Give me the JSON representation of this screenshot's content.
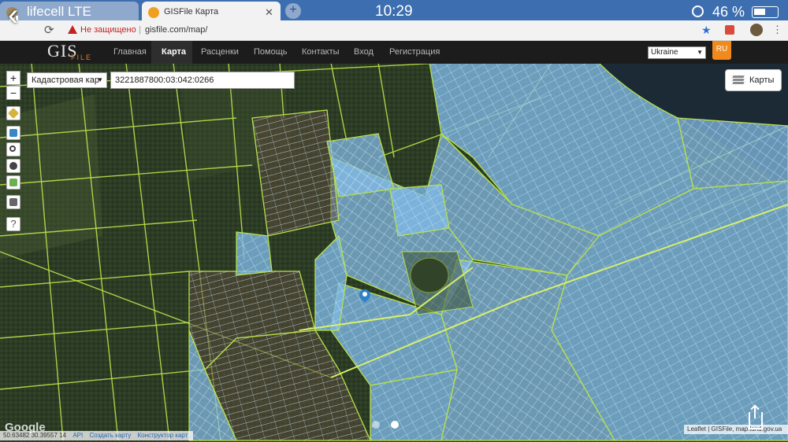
{
  "statusbar": {
    "carrier": "lifecell  LTE",
    "time": "10:29",
    "battery": "46 %"
  },
  "tabs": [
    {
      "title": "",
      "active": false
    },
    {
      "title": "GISFile Карта",
      "active": true
    }
  ],
  "addressbar": {
    "security_warning": "Не защищено",
    "url": "gisfile.com/map/"
  },
  "site": {
    "logo": {
      "gis": "GIS",
      "file": "FILE"
    },
    "nav": [
      {
        "label": "Главная",
        "active": false
      },
      {
        "label": "Карта",
        "active": true
      },
      {
        "label": "Расценки",
        "active": false
      },
      {
        "label": "Помощь",
        "active": false
      },
      {
        "label": "Контакты",
        "active": false
      },
      {
        "label": "Вход",
        "active": false
      },
      {
        "label": "Регистрация",
        "active": false
      }
    ],
    "country": "Ukraine",
    "language": "RU"
  },
  "map": {
    "zoom_in": "+",
    "zoom_out": "−",
    "layer_select": "Кадастровая кар",
    "search_value": "3221887800:03:042:0266",
    "maps_button": "Карты",
    "tools": [
      "ruler-icon",
      "layers-icon",
      "search-icon",
      "clear-icon",
      "terrain-icon",
      "print-icon",
      "help-icon"
    ],
    "help_label": "?",
    "coords": "50.63482 30.39557 14",
    "coord_links": [
      "API",
      "Создать карту",
      "Конструктор карт"
    ],
    "attribution": "Leaflet | GISFile, map.land.gov.ua",
    "watermark": "Google"
  },
  "colors": {
    "statusbar": "#3d6fb0",
    "parcel_fill": "#8ec6f2",
    "parcel_stroke": "#b8e04a",
    "nav_bg": "#1c1c1c",
    "accent": "#f08a1c"
  }
}
